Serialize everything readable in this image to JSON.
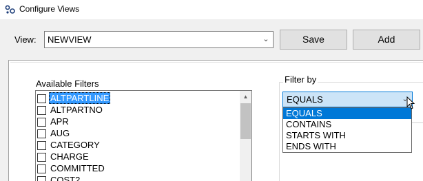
{
  "window": {
    "title": "Configure Views",
    "app_icon": "app-icon"
  },
  "view": {
    "label": "View:",
    "selected": "NEWVIEW"
  },
  "buttons": {
    "save": "Save",
    "add": "Add"
  },
  "available_filters": {
    "label": "Available Filters",
    "items": [
      {
        "label": "ALTPARTLINE",
        "checked": false,
        "selected": true
      },
      {
        "label": "ALTPARTNO",
        "checked": false,
        "selected": false
      },
      {
        "label": "APR",
        "checked": false,
        "selected": false
      },
      {
        "label": "AUG",
        "checked": false,
        "selected": false
      },
      {
        "label": "CATEGORY",
        "checked": false,
        "selected": false
      },
      {
        "label": "CHARGE",
        "checked": false,
        "selected": false
      },
      {
        "label": "COMMITTED",
        "checked": false,
        "selected": false
      },
      {
        "label": "COST2",
        "checked": false,
        "selected": false
      }
    ]
  },
  "filter_by": {
    "label": "Filter by",
    "selected": "EQUALS",
    "options": [
      "EQUALS",
      "CONTAINS",
      "STARTS WITH",
      "ENDS WITH"
    ],
    "highlighted_index": 0
  },
  "colors": {
    "selection": "#3399ff",
    "dropdown_highlight": "#0078d7",
    "combo_focus_bg": "#cce4f7",
    "combo_focus_border": "#0078d7"
  }
}
